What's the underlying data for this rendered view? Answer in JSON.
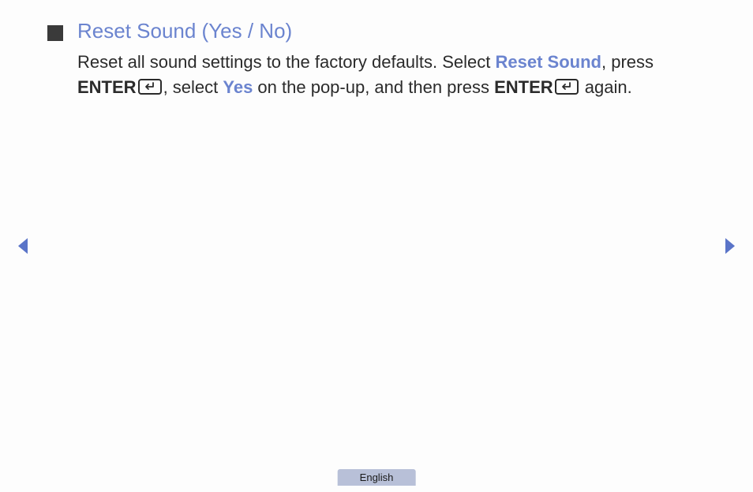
{
  "heading": "Reset Sound (Yes / No)",
  "body": {
    "part1": "Reset all sound settings to the factory defaults. Select ",
    "reset_sound": "Reset Sound",
    "part2": ", press ",
    "enter1": "ENTER",
    "part3": ", select ",
    "yes": "Yes",
    "part4": " on the pop-up, and then press ",
    "enter2": "ENTER",
    "part5": " again."
  },
  "language": "English"
}
